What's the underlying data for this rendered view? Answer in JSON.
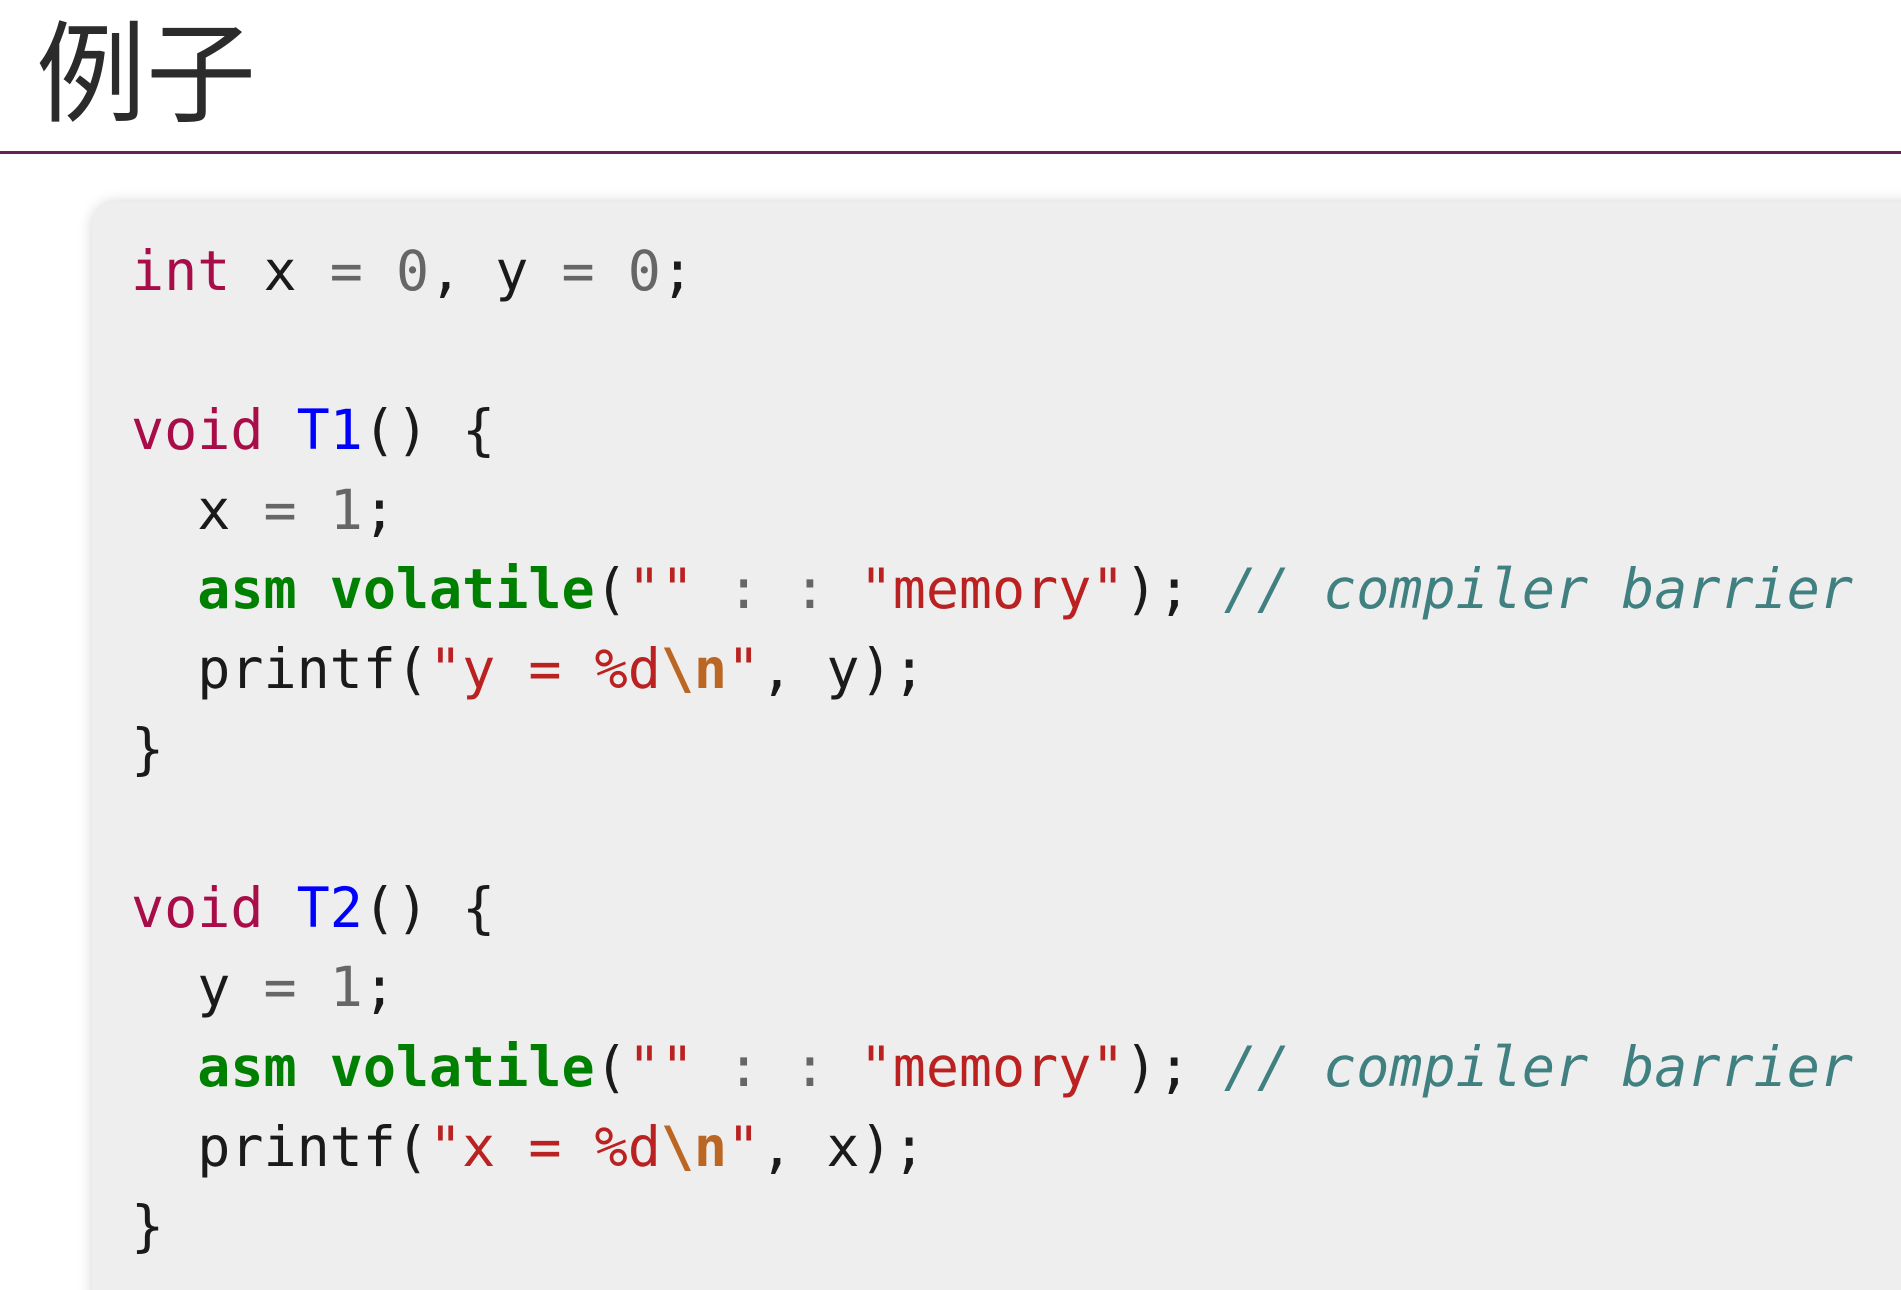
{
  "heading": "例子",
  "code": {
    "lines": [
      [
        [
          "kw",
          "int"
        ],
        [
          "plain",
          " x "
        ],
        [
          "op",
          "="
        ],
        [
          "plain",
          " "
        ],
        [
          "num",
          "0"
        ],
        [
          "plain",
          ", y "
        ],
        [
          "op",
          "="
        ],
        [
          "plain",
          " "
        ],
        [
          "num",
          "0"
        ],
        [
          "plain",
          ";"
        ]
      ],
      [],
      [
        [
          "kw",
          "void"
        ],
        [
          "plain",
          " "
        ],
        [
          "fn",
          "T1"
        ],
        [
          "plain",
          "() {"
        ]
      ],
      [
        [
          "plain",
          "  x "
        ],
        [
          "op",
          "="
        ],
        [
          "plain",
          " "
        ],
        [
          "num",
          "1"
        ],
        [
          "plain",
          ";"
        ]
      ],
      [
        [
          "plain",
          "  "
        ],
        [
          "kw2",
          "asm"
        ],
        [
          "plain",
          " "
        ],
        [
          "kw2",
          "volatile"
        ],
        [
          "plain",
          "("
        ],
        [
          "str",
          "\"\""
        ],
        [
          "plain",
          " "
        ],
        [
          "op",
          ":"
        ],
        [
          "plain",
          " "
        ],
        [
          "op",
          ":"
        ],
        [
          "plain",
          " "
        ],
        [
          "str",
          "\"memory\""
        ],
        [
          "plain",
          "); "
        ],
        [
          "cm",
          "// compiler barrier"
        ]
      ],
      [
        [
          "plain",
          "  printf("
        ],
        [
          "str",
          "\"y = %d"
        ],
        [
          "esc",
          "\\n"
        ],
        [
          "str",
          "\""
        ],
        [
          "plain",
          ", y);"
        ]
      ],
      [
        [
          "plain",
          "}"
        ]
      ],
      [],
      [
        [
          "kw",
          "void"
        ],
        [
          "plain",
          " "
        ],
        [
          "fn",
          "T2"
        ],
        [
          "plain",
          "() {"
        ]
      ],
      [
        [
          "plain",
          "  y "
        ],
        [
          "op",
          "="
        ],
        [
          "plain",
          " "
        ],
        [
          "num",
          "1"
        ],
        [
          "plain",
          ";"
        ]
      ],
      [
        [
          "plain",
          "  "
        ],
        [
          "kw2",
          "asm"
        ],
        [
          "plain",
          " "
        ],
        [
          "kw2",
          "volatile"
        ],
        [
          "plain",
          "("
        ],
        [
          "str",
          "\"\""
        ],
        [
          "plain",
          " "
        ],
        [
          "op",
          ":"
        ],
        [
          "plain",
          " "
        ],
        [
          "op",
          ":"
        ],
        [
          "plain",
          " "
        ],
        [
          "str",
          "\"memory\""
        ],
        [
          "plain",
          "); "
        ],
        [
          "cm",
          "// compiler barrier"
        ]
      ],
      [
        [
          "plain",
          "  printf("
        ],
        [
          "str",
          "\"x = %d"
        ],
        [
          "esc",
          "\\n"
        ],
        [
          "str",
          "\""
        ],
        [
          "plain",
          ", x);"
        ]
      ],
      [
        [
          "plain",
          "}"
        ]
      ]
    ]
  },
  "colors": {
    "keyword": "#a90d49",
    "function_name": "#0000ff",
    "number": "#666666",
    "string": "#ba2121",
    "escape": "#bb6622",
    "builtin_keyword": "#008000",
    "comment": "#408080",
    "code_background": "#eeeeee",
    "heading_rule": "#6b1e5a"
  }
}
